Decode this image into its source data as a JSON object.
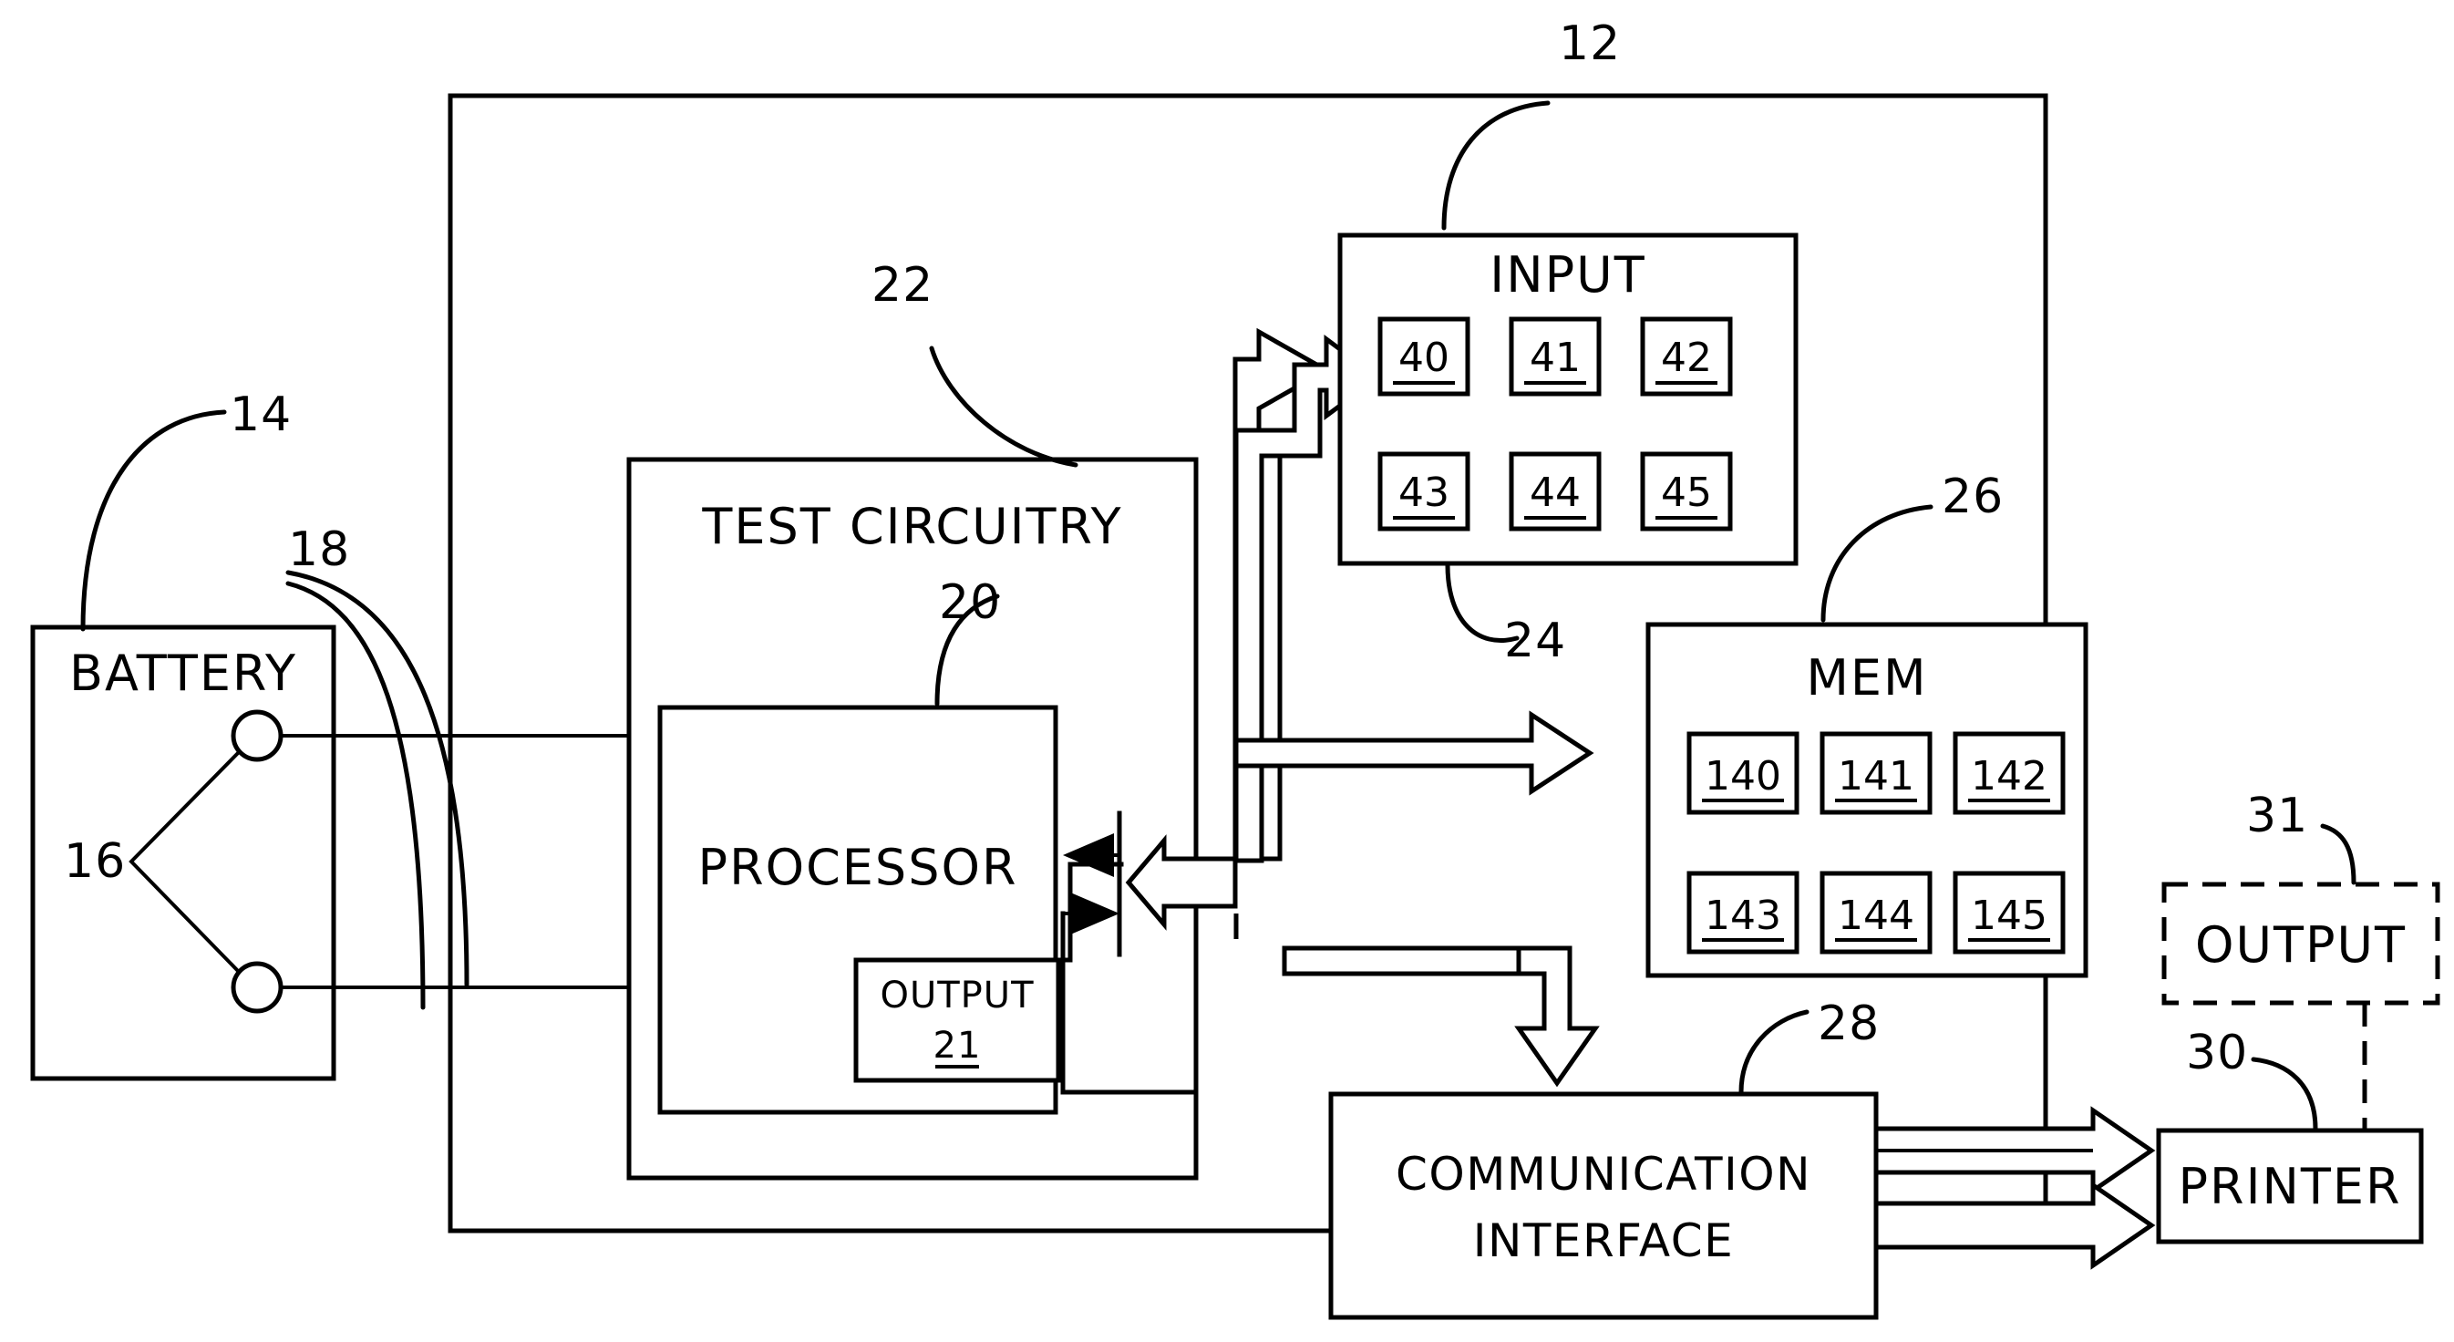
{
  "figure": {
    "title": "Battery test system block diagram",
    "type": "patent-block-diagram",
    "ink_color": "#000000",
    "background_color": "#ffffff"
  },
  "reference_numerals": {
    "system": "12",
    "battery": "14",
    "battery_terminals": "16",
    "battery_leads": "18",
    "processor": "20",
    "processor_output": "21",
    "test_circuitry": "22",
    "input": "24",
    "memory": "26",
    "communication_interface": "28",
    "printer": "30",
    "printer_output": "31"
  },
  "blocks": {
    "battery": {
      "label": "BATTERY"
    },
    "test_circuitry": {
      "label": "TEST CIRCUITRY"
    },
    "processor": {
      "label": "PROCESSOR"
    },
    "processor_output": {
      "label": "OUTPUT",
      "ref": "21"
    },
    "input": {
      "label": "INPUT",
      "cells": [
        "40",
        "41",
        "42",
        "43",
        "44",
        "45"
      ]
    },
    "memory": {
      "label": "MEM",
      "cells": [
        "140",
        "141",
        "142",
        "143",
        "144",
        "145"
      ]
    },
    "communication_interface": {
      "label_line1": "COMMUNICATION",
      "label_line2": "INTERFACE"
    },
    "printer": {
      "label": "PRINTER"
    },
    "printer_output": {
      "label": "OUTPUT"
    }
  }
}
